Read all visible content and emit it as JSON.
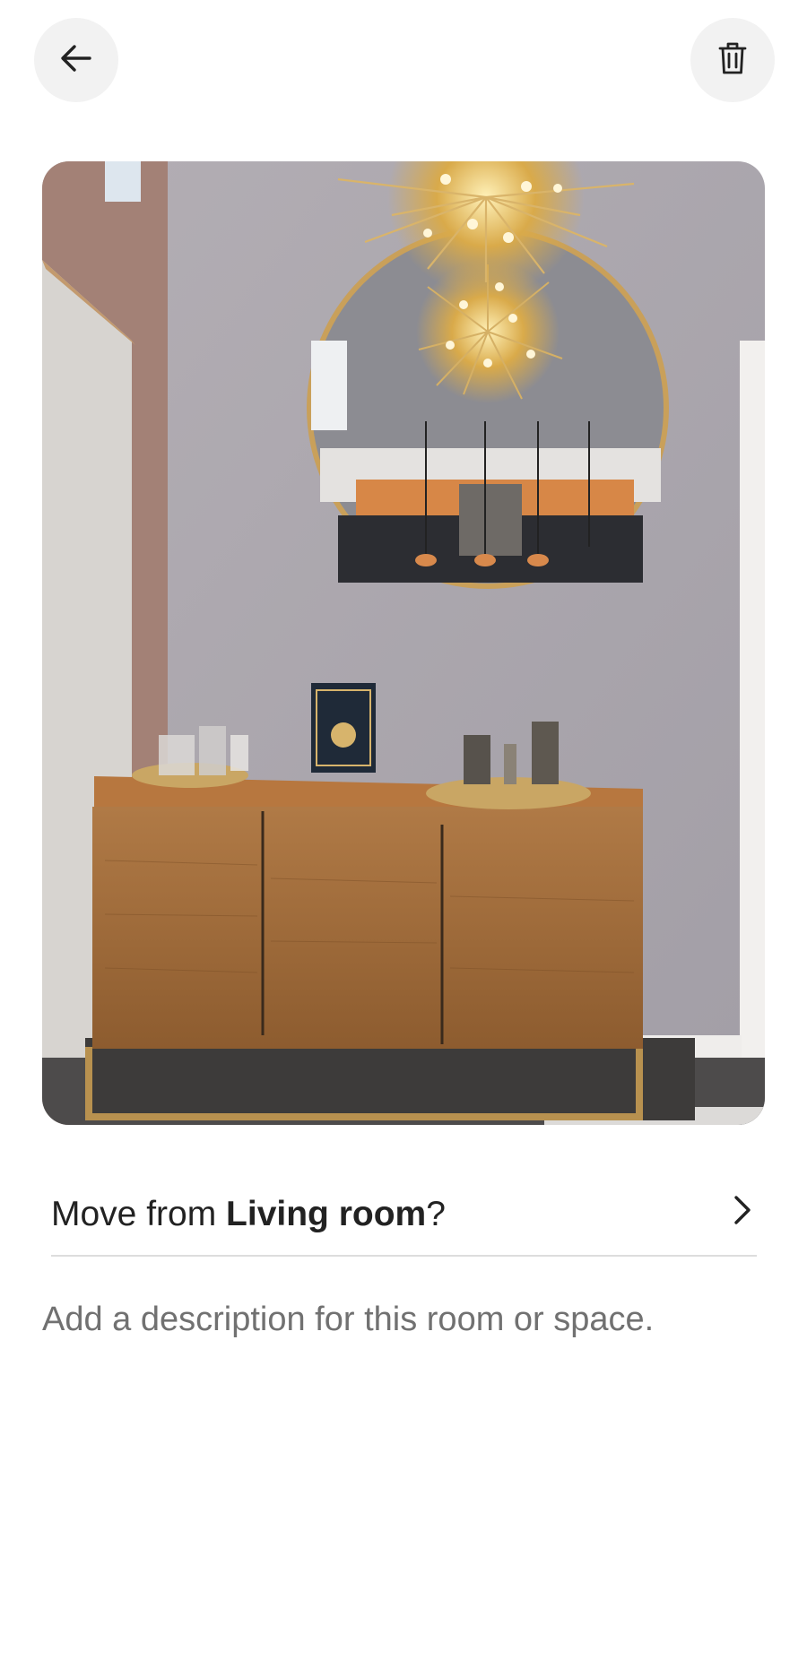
{
  "header": {
    "back_icon": "arrow-left-icon",
    "delete_icon": "trash-icon"
  },
  "photo": {
    "subject": "living room sideboard with round mirror and sputnik chandelier"
  },
  "move": {
    "prefix": "Move from ",
    "room": "Living room",
    "suffix": "?",
    "chevron_icon": "chevron-right-icon"
  },
  "description": {
    "placeholder": "Add a description for this room or space."
  },
  "colors": {
    "text": "#222222",
    "muted": "#717171",
    "button_bg": "#f2f2f2",
    "divider": "#dddddd"
  }
}
